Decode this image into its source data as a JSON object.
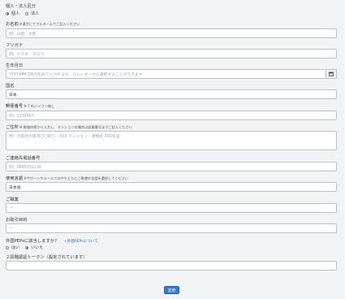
{
  "form": {
    "type_label": "個人・法人区分",
    "type_options": [
      "個人",
      "法人"
    ],
    "type_selected": 0,
    "name_label": "お名前",
    "name_hint": "※漢字にてフルネームでご記入ください",
    "name_placeholder": "例）山田　太郎",
    "kana_label": "フリガナ",
    "kana_placeholder": "例）ヤマダ　タロウ",
    "birth_label": "生年月日",
    "birth_placeholder": "YYYY-MM-DDの形式で入力するか、カレンダーから選択することができます",
    "country_label": "国名",
    "country_value": "日本",
    "zip_label": "郵便番号",
    "zip_hint": "※ 7 桁ハイフン無し",
    "zip_placeholder": "例）1234567",
    "address_label": "ご住所",
    "address_hint": "※ 都道府県から入力し、マンションの場合は部屋番号までご記入ください",
    "address_placeholder": "例）大阪府大阪市〇〇町〇－000 マンション・建物名 000号室",
    "phone_label": "ご連絡先電話番号",
    "phone_placeholder": "例）0665332230",
    "lang_label": "使用言語",
    "lang_hint": "※サポートやメールでのやりとりにご希望の言語を選択してください",
    "lang_value": "日本語",
    "job_label": "ご職業",
    "job_value": "---",
    "purpose_label": "お取引目的",
    "purpose_value": "---",
    "peps_label": "外国PEPsに該当しますか？",
    "peps_link": "＋外国PEPsについて",
    "peps_options": [
      "はい",
      "いいえ"
    ],
    "peps_selected": 1,
    "token_label": "２段階認証トークン（設定されています）",
    "token_value": "",
    "submit_label": "変更"
  },
  "colors": {
    "background": "#f1f3f5",
    "accent": "#3a78c2",
    "link": "#2d6fb4"
  }
}
